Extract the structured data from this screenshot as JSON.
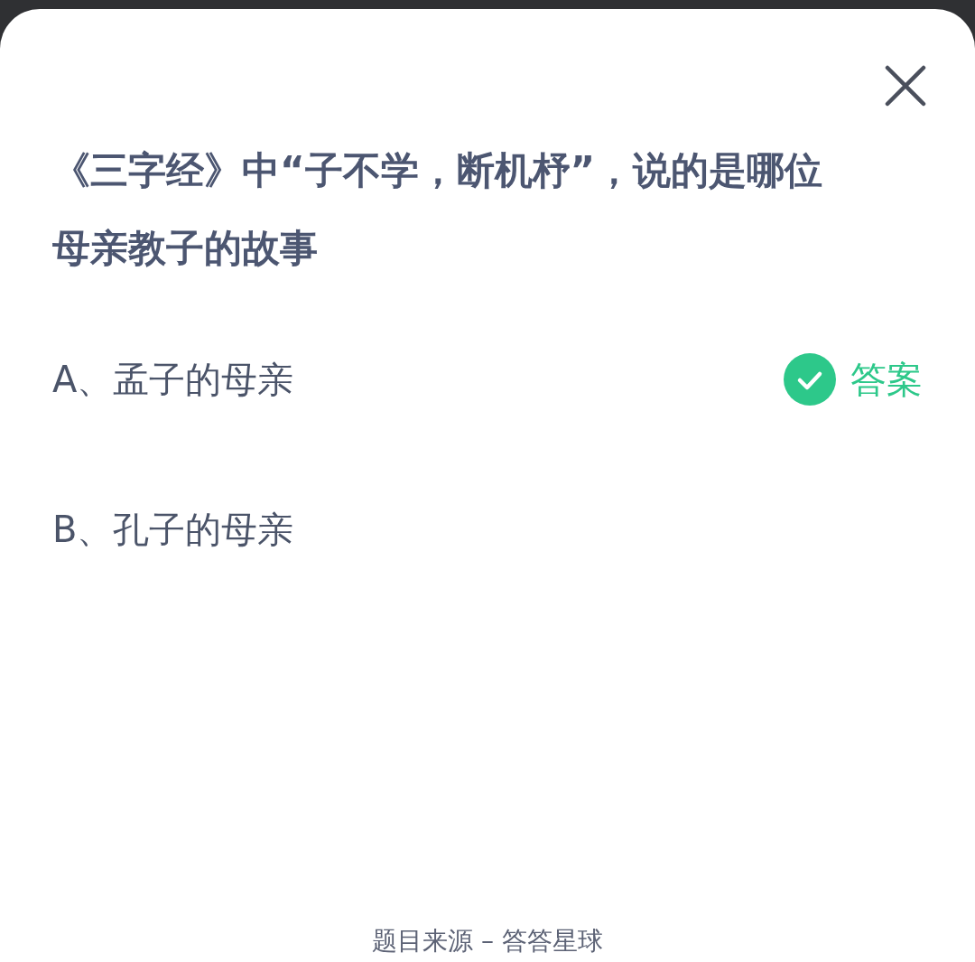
{
  "question": "《三字经》中“子不学，断机杼”，说的是哪位母亲教子的故事",
  "options": [
    {
      "text": "A、孟子的母亲",
      "correct": true
    },
    {
      "text": "B、孔子的母亲",
      "correct": false
    }
  ],
  "answer_badge": "答案",
  "footer": "题目来源 – 答答星球"
}
